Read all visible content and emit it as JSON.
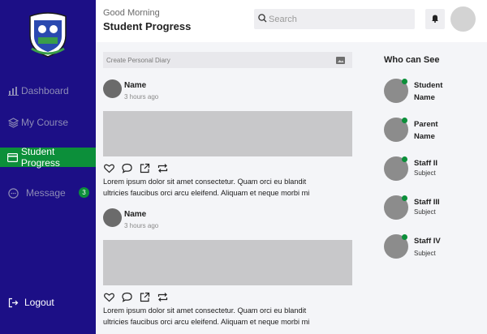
{
  "sidebar": {
    "items": [
      {
        "label": "Dashboard",
        "icon": "bar-chart-icon"
      },
      {
        "label": "My Course",
        "icon": "layers-icon"
      },
      {
        "label": "Student Progress",
        "icon": "card-icon",
        "active": true
      },
      {
        "label": "Message",
        "icon": "chat-icon",
        "badge": "3"
      }
    ],
    "logout": "Logout"
  },
  "header": {
    "greeting": "Good Morning",
    "title": "Student Progress",
    "search_placeholder": "Search"
  },
  "feed": {
    "diary_placeholder": "Create Personal Diary",
    "posts": [
      {
        "name": "Name",
        "time": "3 hours ago",
        "text_line1": "Lorem ipsum dolor sit amet consectetur. Quam orci eu blandit",
        "text_line2": "ultricies faucibus orci arcu eleifend. Aliquam et neque morbi mi"
      },
      {
        "name": "Name",
        "time": "3 hours ago",
        "text_line1": "Lorem ipsum dolor sit amet consectetur. Quam orci eu blandit",
        "text_line2": "ultricies faucibus orci arcu eleifend. Aliquam et neque morbi mi"
      }
    ]
  },
  "who_can_see": {
    "title": "Who can See",
    "people": [
      {
        "line1": "Student",
        "line2": "Name"
      },
      {
        "line1": "Parent",
        "line2": "Name"
      },
      {
        "line1": "Staff II",
        "line2": "Subject"
      },
      {
        "line1": "Staff III",
        "line2": "Subject"
      },
      {
        "line1": "Staff IV",
        "line2": "Subject"
      }
    ]
  },
  "colors": {
    "sidebar": "#1c0f86",
    "accent": "#0c8f3a",
    "background": "#f4f5f8"
  }
}
